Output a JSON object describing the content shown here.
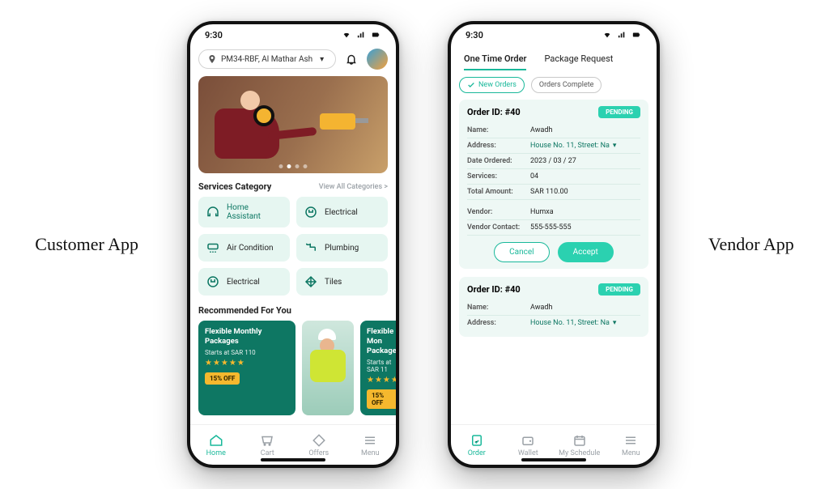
{
  "labels": {
    "customer": "Customer App",
    "vendor": "Vendor App"
  },
  "status_time": "9:30",
  "customer": {
    "location": "PM34-RBF, Al Mathar Ash",
    "services_heading": "Services Category",
    "view_all": "View All Categories >",
    "categories": [
      {
        "label": "Home Assistant"
      },
      {
        "label": "Electrical"
      },
      {
        "label": "Air Condition"
      },
      {
        "label": "Plumbing"
      },
      {
        "label": "Electrical"
      },
      {
        "label": "Tiles"
      }
    ],
    "recommended_heading": "Recommended For You",
    "rec": {
      "title": "Flexible Monthly Packages",
      "subtitle": "Starts at SAR 110",
      "stars": "★★★★★",
      "badge": "15% OFF",
      "title2": "Flexible Mon\nPackages",
      "subtitle2": "Starts at SAR 11"
    },
    "nav": {
      "home": "Home",
      "cart": "Cart",
      "offers": "Offers",
      "menu": "Menu"
    }
  },
  "vendor": {
    "tabs": {
      "one_time": "One Time Order",
      "package": "Package Request"
    },
    "filters": {
      "new": "New Orders",
      "complete": "Orders Complete"
    },
    "order": {
      "id_label": "Order ID: #40",
      "status": "PENDING",
      "fields": {
        "name_k": "Name:",
        "name_v": "Awadh",
        "address_k": "Address:",
        "address_v": "House No. 11, Street: Na",
        "date_k": "Date Ordered:",
        "date_v": "2023 / 03 / 27",
        "services_k": "Services:",
        "services_v": "04",
        "total_k": "Total Amount:",
        "total_v": "SAR 110.00",
        "vendor_k": "Vendor:",
        "vendor_v": "Humxa",
        "contact_k": "Vendor Contact:",
        "contact_v": "555-555-555"
      },
      "cancel": "Cancel",
      "accept": "Accept"
    },
    "nav": {
      "order": "Order",
      "wallet": "Wallet",
      "schedule": "My Schedule",
      "menu": "Menu"
    }
  }
}
